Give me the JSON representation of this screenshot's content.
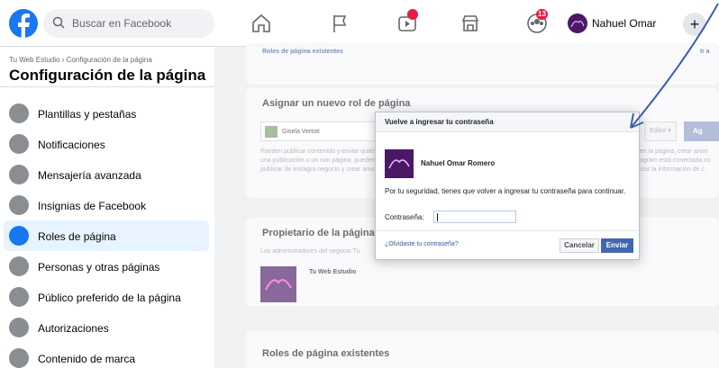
{
  "topbar": {
    "search_placeholder": "Buscar en Facebook",
    "profile_name": "Nahuel Omar",
    "plus": "+",
    "badges": {
      "watch": "",
      "groups": "13"
    }
  },
  "sidebar": {
    "breadcrumb": "Tu Web Estudio › Configuración de la página",
    "title": "Configuración de la página",
    "items": [
      {
        "label": "Plantillas y pestañas",
        "icon": "grid-icon"
      },
      {
        "label": "Notificaciones",
        "icon": "globe-icon"
      },
      {
        "label": "Mensajería avanzada",
        "icon": "messenger-icon"
      },
      {
        "label": "Insignias de Facebook",
        "icon": "badge-icon"
      },
      {
        "label": "Roles de página",
        "icon": "user-icon"
      },
      {
        "label": "Personas y otras páginas",
        "icon": "people-icon"
      },
      {
        "label": "Público preferido de la página",
        "icon": "people-icon"
      },
      {
        "label": "Autorizaciones",
        "icon": "authorization-icon"
      },
      {
        "label": "Contenido de marca",
        "icon": "branded-content-icon"
      }
    ]
  },
  "main": {
    "existing_roles_link": "Roles de página existentes",
    "existing_roles_edge": "Ir a",
    "assign": {
      "title": "Asignar un nuevo rol de página",
      "person": "Gisela Vertoti",
      "role": "Editor ▾",
      "add": "Ag",
      "desc_left": "Pueden publicar contenido y enviar quién creó una publicación o un con página, pueden publicar de Instagra negocio y crear anuncios.",
      "desc_right": "en la página, crear anun agram está conectada co izar la información de c"
    },
    "owner": {
      "title": "Propietario de la página",
      "desc": "Los administradores del negocio Tu",
      "business": "Tu Web Estudio"
    },
    "existing_roles_title": "Roles de página existentes"
  },
  "dialog": {
    "title": "Vuelve a ingresar tu contraseña",
    "user": "Nahuel Omar Romero",
    "message": "Por tu seguridad, tienes que volver a ingresar tu contraseña para continuar.",
    "password_label": "Contraseña:",
    "forgot": "¿Olvidaste tu contraseña?",
    "cancel": "Cancelar",
    "send": "Enviar"
  },
  "colors": {
    "accent": "#1877f2",
    "button": "#4267b2",
    "annotation": "#3b5fae",
    "badge": "#e41e3f"
  }
}
